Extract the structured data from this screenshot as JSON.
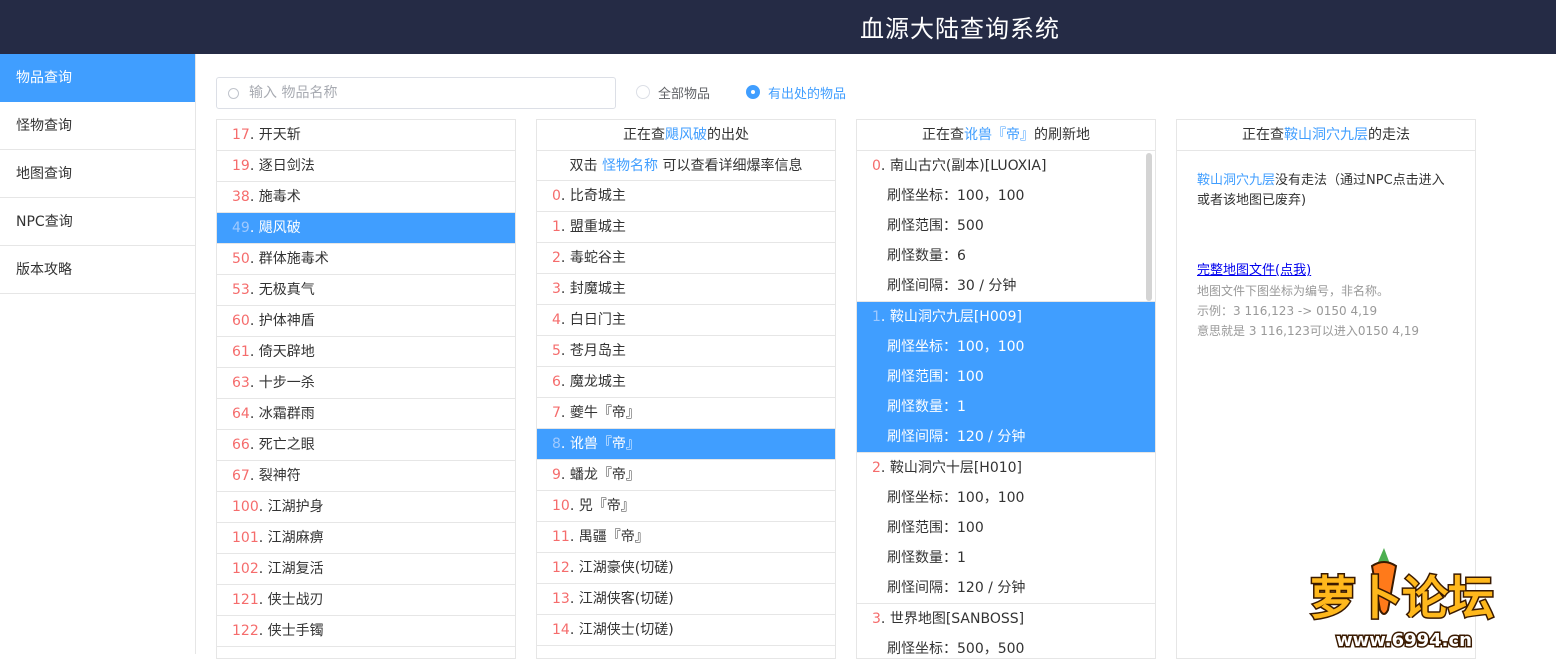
{
  "app": {
    "title": "血源大陆查询系统"
  },
  "sidebar": {
    "items": [
      {
        "label": "物品查询",
        "active": true
      },
      {
        "label": "怪物查询"
      },
      {
        "label": "地图查询"
      },
      {
        "label": "NPC查询"
      },
      {
        "label": "版本攻略"
      }
    ]
  },
  "search": {
    "placeholder": "输入 物品名称",
    "value": ""
  },
  "filters": [
    {
      "label": "全部物品",
      "checked": false
    },
    {
      "label": "有出处的物品",
      "checked": true
    }
  ],
  "items_list": [
    {
      "num": "17",
      "name": "开天斩"
    },
    {
      "num": "19",
      "name": "逐日剑法"
    },
    {
      "num": "38",
      "name": "施毒术"
    },
    {
      "num": "49",
      "name": "飓风破",
      "active": true
    },
    {
      "num": "50",
      "name": "群体施毒术"
    },
    {
      "num": "53",
      "name": "无极真气"
    },
    {
      "num": "60",
      "name": "护体神盾"
    },
    {
      "num": "61",
      "name": "倚天辟地"
    },
    {
      "num": "63",
      "name": "十步一杀"
    },
    {
      "num": "64",
      "name": "冰霜群雨"
    },
    {
      "num": "66",
      "name": "死亡之眼"
    },
    {
      "num": "67",
      "name": "裂神符"
    },
    {
      "num": "100",
      "name": "江湖护身"
    },
    {
      "num": "101",
      "name": "江湖麻痹"
    },
    {
      "num": "102",
      "name": "江湖复活"
    },
    {
      "num": "121",
      "name": "侠士战刃"
    },
    {
      "num": "122",
      "name": "侠士手镯"
    }
  ],
  "source_panel": {
    "head_prefix": "正在查",
    "head_item": "飓风破",
    "head_suffix": "的出处",
    "sub_prefix": "双击",
    "sub_link": "怪物名称",
    "sub_suffix": "可以查看详细爆率信息",
    "monsters": [
      {
        "num": "0",
        "name": "比奇城主"
      },
      {
        "num": "1",
        "name": "盟重城主"
      },
      {
        "num": "2",
        "name": "毒蛇谷主"
      },
      {
        "num": "3",
        "name": "封魔城主"
      },
      {
        "num": "4",
        "name": "白日门主"
      },
      {
        "num": "5",
        "name": "苍月岛主"
      },
      {
        "num": "6",
        "name": "魔龙城主"
      },
      {
        "num": "7",
        "name": "夔牛『帝』"
      },
      {
        "num": "8",
        "name": "讹兽『帝』",
        "active": true
      },
      {
        "num": "9",
        "name": "蟠龙『帝』"
      },
      {
        "num": "10",
        "name": "兕『帝』"
      },
      {
        "num": "11",
        "name": "禺疆『帝』"
      },
      {
        "num": "12",
        "name": "江湖豪侠(切磋)"
      },
      {
        "num": "13",
        "name": "江湖侠客(切磋)"
      },
      {
        "num": "14",
        "name": "江湖侠士(切磋)"
      }
    ]
  },
  "spawn_panel": {
    "head_prefix": "正在查",
    "head_monster": "讹兽『帝』",
    "head_suffix": "的刷新地",
    "locations": [
      {
        "num": "0",
        "name": "南山古穴(副本)[LUOXIA]",
        "coord": "刷怪坐标：100，100",
        "range": "刷怪范围：500",
        "count": "刷怪数量：6",
        "interval": "刷怪间隔：30 / 分钟"
      },
      {
        "num": "1",
        "name": "鞍山洞穴九层[H009]",
        "coord": "刷怪坐标：100，100",
        "range": "刷怪范围：100",
        "count": "刷怪数量：1",
        "interval": "刷怪间隔：120 / 分钟",
        "active": true
      },
      {
        "num": "2",
        "name": "鞍山洞穴十层[H010]",
        "coord": "刷怪坐标：100，100",
        "range": "刷怪范围：100",
        "count": "刷怪数量：1",
        "interval": "刷怪间隔：120 / 分钟"
      },
      {
        "num": "3",
        "name": "世界地图[SANBOSS]",
        "coord": "刷怪坐标：500，500"
      }
    ]
  },
  "route_panel": {
    "head_prefix": "正在查",
    "head_map": "鞍山洞穴九层",
    "head_suffix": "的走法",
    "desc_map": "鞍山洞穴九层",
    "desc_text": "没有走法（通过NPC点击进入或者该地图已废弃)",
    "link": "完整地图文件(点我)",
    "note1": "地图文件下图坐标为编号，非名称。",
    "note2": "示例：3 116,123 -> 0150 4,19",
    "note3": "意思就是 3 116,123可以进入0150 4,19"
  },
  "watermark": {
    "text": "萝卜论坛",
    "url": "www.6994.cn"
  },
  "colors": {
    "topbar": "#252b45",
    "accent": "#409eff",
    "number": "#f56c6c"
  }
}
